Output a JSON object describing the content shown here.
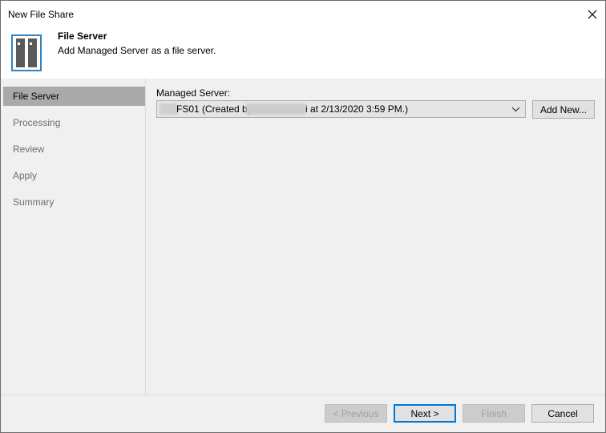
{
  "window": {
    "title": "New File Share"
  },
  "header": {
    "title": "File Server",
    "subtitle": "Add Managed Server as a file server.",
    "icon": "server-icon"
  },
  "sidebar": {
    "items": [
      {
        "label": "File Server",
        "active": true
      },
      {
        "label": "Processing",
        "active": false
      },
      {
        "label": "Review",
        "active": false
      },
      {
        "label": "Apply",
        "active": false
      },
      {
        "label": "Summary",
        "active": false
      }
    ]
  },
  "content": {
    "managed_server_label": "Managed Server:",
    "managed_server_value_part1": "FS01 (Created by",
    "managed_server_value_part2": "i at 2/13/2020 3:59 PM.)",
    "add_new_label": "Add New..."
  },
  "footer": {
    "previous_label": "< Previous",
    "next_label": "Next >",
    "finish_label": "Finish",
    "cancel_label": "Cancel"
  },
  "colors": {
    "accent": "#0078d7",
    "icon_border": "#2f82c4",
    "active_nav_bg": "#aaaaaa",
    "panel_bg": "#f0f0f0"
  }
}
